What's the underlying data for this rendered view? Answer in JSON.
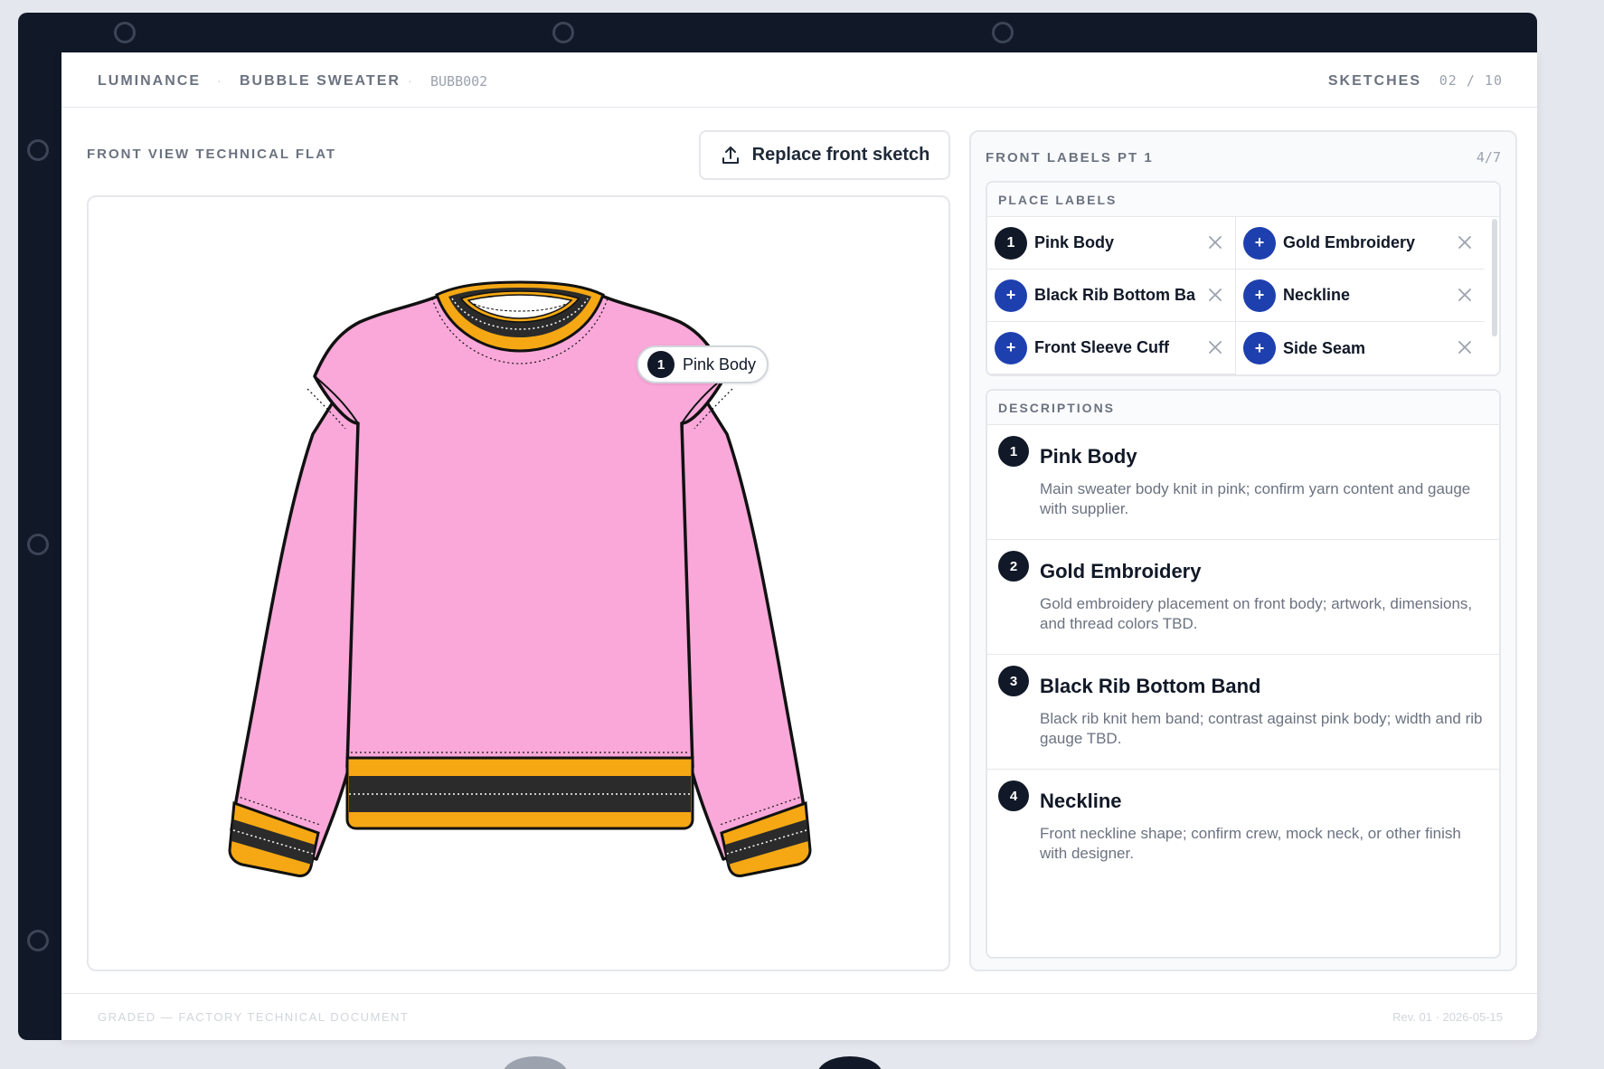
{
  "header": {
    "brand": "LUMINANCE",
    "product": "BUBBLE SWEATER",
    "code": "BUBB002",
    "sketches_label": "SKETCHES",
    "sketches_count": "02 / 10"
  },
  "view": {
    "title": "FRONT VIEW TECHNICAL FLAT",
    "replace_button": "Replace front sketch",
    "pin": {
      "number": "1",
      "label": "Pink Body"
    }
  },
  "panel": {
    "title": "FRONT LABELS PT 1",
    "count": "4/7",
    "place_labels_heading": "PLACE LABELS",
    "labels": [
      {
        "marker": "1",
        "name": "Pink Body",
        "placed": true
      },
      {
        "marker": "+",
        "name": "Gold Embroidery",
        "placed": false
      },
      {
        "marker": "+",
        "name": "Black Rib Bottom Band",
        "placed": false
      },
      {
        "marker": "+",
        "name": "Neckline",
        "placed": false
      },
      {
        "marker": "+",
        "name": "Front Sleeve Cuff",
        "placed": false
      },
      {
        "marker": "+",
        "name": "Side Seam",
        "placed": false
      }
    ],
    "descriptions_heading": "DESCRIPTIONS",
    "descriptions": [
      {
        "number": "1",
        "title": "Pink Body",
        "text": "Main sweater body knit in pink; confirm yarn content and gauge with supplier."
      },
      {
        "number": "2",
        "title": "Gold Embroidery",
        "text": "Gold embroidery placement on front body; artwork, dimensions, and thread colors TBD."
      },
      {
        "number": "3",
        "title": "Black Rib Bottom Band",
        "text": "Black rib knit hem band; contrast against pink body; width and rib gauge TBD."
      },
      {
        "number": "4",
        "title": "Neckline",
        "text": "Front neckline shape; confirm crew, mock neck, or other finish with designer."
      }
    ]
  },
  "footer": {
    "left": "GRADED — FACTORY TECHNICAL DOCUMENT",
    "right": "Rev. 01 · 2026-05-15"
  },
  "colors": {
    "sweater_body": "#f9a8d9",
    "gold_trim": "#f5a814",
    "rib_black": "#2b2b2b",
    "accent_blue": "#1e40af",
    "ink": "#111827"
  }
}
